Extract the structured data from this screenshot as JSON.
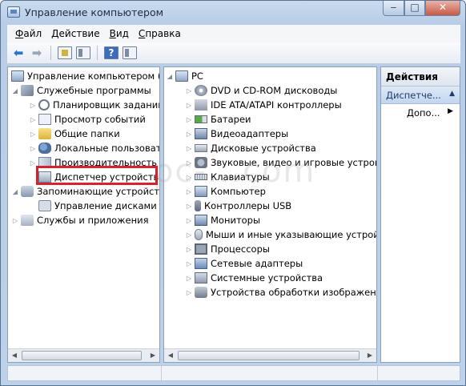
{
  "window": {
    "title": "Управление компьютером",
    "controls": {
      "minimize": "‒",
      "maximize": "□",
      "close": "✕"
    }
  },
  "menu": [
    {
      "label": "Файл",
      "key": "Ф",
      "rest": "айл"
    },
    {
      "label": "Действие",
      "key": "Д",
      "rest": "ействие"
    },
    {
      "label": "Вид",
      "key": "В",
      "rest": "ид"
    },
    {
      "label": "Справка",
      "key": "С",
      "rest": "правка"
    }
  ],
  "toolbar": [
    "back-arrow-icon",
    "forward-arrow-icon",
    "up-folder-icon",
    "show-hide-tree-icon",
    "help-icon",
    "action-pane-icon"
  ],
  "left_tree": {
    "root": "Управление компьютером (локальным)",
    "items": [
      {
        "label": "Служебные программы"
      },
      {
        "label": "Планировщик заданий"
      },
      {
        "label": "Просмотр событий"
      },
      {
        "label": "Общие папки"
      },
      {
        "label": "Локальные пользователи"
      },
      {
        "label": "Производительность"
      },
      {
        "label": "Диспетчер устройств"
      },
      {
        "label": "Запоминающие устройства"
      },
      {
        "label": "Управление дисками"
      },
      {
        "label": "Службы и приложения"
      }
    ]
  },
  "device_tree": {
    "root": "PC",
    "items": [
      {
        "label": "DVD и CD-ROM дисководы"
      },
      {
        "label": "IDE ATA/ATAPI контроллеры"
      },
      {
        "label": "Батареи"
      },
      {
        "label": "Видеоадаптеры"
      },
      {
        "label": "Дисковые устройства"
      },
      {
        "label": "Звуковые, видео и игровые устройства"
      },
      {
        "label": "Клавиатуры"
      },
      {
        "label": "Компьютер"
      },
      {
        "label": "Контроллеры USB"
      },
      {
        "label": "Мониторы"
      },
      {
        "label": "Мыши и иные указывающие устройства"
      },
      {
        "label": "Процессоры"
      },
      {
        "label": "Сетевые адаптеры"
      },
      {
        "label": "Системные устройства"
      },
      {
        "label": "Устройства обработки изображений"
      }
    ]
  },
  "actions": {
    "header": "Действия",
    "section": "Диспетче...",
    "more": "Допо..."
  },
  "watermark": "pc-...com",
  "colors": {
    "highlight": "#d3232e",
    "accent": "#2a74c9"
  }
}
